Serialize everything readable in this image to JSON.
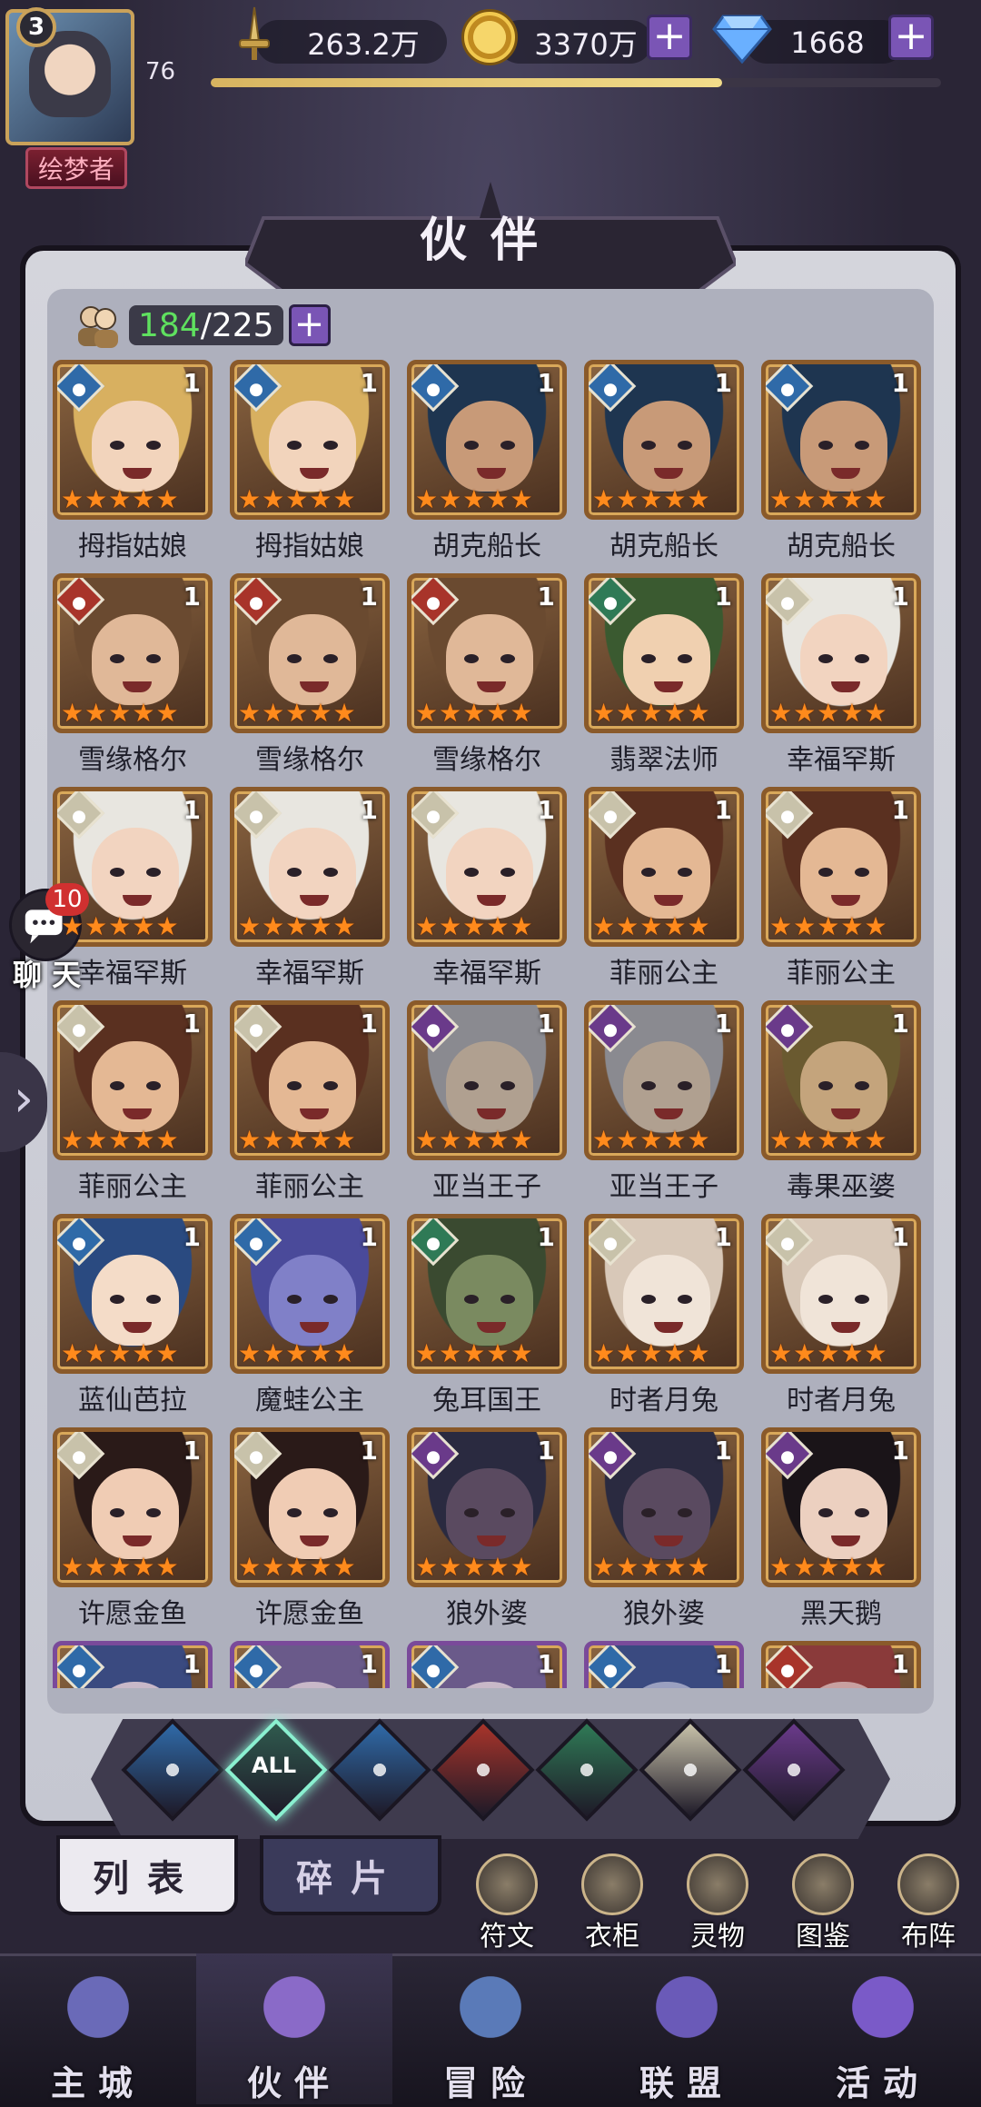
{
  "player": {
    "level": "3",
    "exp_level": "76",
    "title": "绘梦者",
    "exp_progress": 0.7
  },
  "resources": {
    "power": "263.2万",
    "gold": "3370万",
    "diamond": "1668"
  },
  "page": {
    "title": "伙伴"
  },
  "partner_count": {
    "current": "184",
    "total": "/225"
  },
  "colors": {
    "water": "#2f6aa8",
    "fire": "#a8342a",
    "wind": "#2f7a56",
    "light": "#c8c2aa",
    "dark": "#6a3a8a"
  },
  "partners": [
    {
      "name": "拇指姑娘",
      "element": "water",
      "count": "1",
      "stars": 5,
      "hair": "#d8b060",
      "skin": "#f2d4bc"
    },
    {
      "name": "拇指姑娘",
      "element": "water",
      "count": "1",
      "stars": 5,
      "hair": "#d8b060",
      "skin": "#f2d4bc"
    },
    {
      "name": "胡克船长",
      "element": "water",
      "count": "1",
      "stars": 5,
      "hair": "#1e3550",
      "skin": "#c89a78"
    },
    {
      "name": "胡克船长",
      "element": "water",
      "count": "1",
      "stars": 5,
      "hair": "#1e3550",
      "skin": "#c89a78"
    },
    {
      "name": "胡克船长",
      "element": "water",
      "count": "1",
      "stars": 5,
      "hair": "#1e3550",
      "skin": "#c89a78"
    },
    {
      "name": "雪缘格尔",
      "element": "fire",
      "count": "1",
      "stars": 5,
      "hair": "#6a4a30",
      "skin": "#e0b898"
    },
    {
      "name": "雪缘格尔",
      "element": "fire",
      "count": "1",
      "stars": 5,
      "hair": "#6a4a30",
      "skin": "#e0b898"
    },
    {
      "name": "雪缘格尔",
      "element": "fire",
      "count": "1",
      "stars": 5,
      "hair": "#6a4a30",
      "skin": "#e0b898"
    },
    {
      "name": "翡翠法师",
      "element": "wind",
      "count": "1",
      "stars": 5,
      "hair": "#3a5a30",
      "skin": "#f0d0b0"
    },
    {
      "name": "幸福罕斯",
      "element": "light",
      "count": "1",
      "stars": 5,
      "hair": "#e8e6e0",
      "skin": "#f2d4c0"
    },
    {
      "name": "幸福罕斯",
      "element": "light",
      "count": "1",
      "stars": 5,
      "hair": "#e8e6e0",
      "skin": "#f2d4c0"
    },
    {
      "name": "幸福罕斯",
      "element": "light",
      "count": "1",
      "stars": 5,
      "hair": "#e8e6e0",
      "skin": "#f2d4c0"
    },
    {
      "name": "幸福罕斯",
      "element": "light",
      "count": "1",
      "stars": 5,
      "hair": "#e8e6e0",
      "skin": "#f2d4c0"
    },
    {
      "name": "菲丽公主",
      "element": "light",
      "count": "1",
      "stars": 5,
      "hair": "#5a3020",
      "skin": "#e4b894"
    },
    {
      "name": "菲丽公主",
      "element": "light",
      "count": "1",
      "stars": 5,
      "hair": "#5a3020",
      "skin": "#e4b894"
    },
    {
      "name": "菲丽公主",
      "element": "light",
      "count": "1",
      "stars": 5,
      "hair": "#5a3020",
      "skin": "#e4b894"
    },
    {
      "name": "菲丽公主",
      "element": "light",
      "count": "1",
      "stars": 5,
      "hair": "#5a3020",
      "skin": "#e4b894"
    },
    {
      "name": "亚当王子",
      "element": "dark",
      "count": "1",
      "stars": 5,
      "hair": "#8a8a90",
      "skin": "#b0a090"
    },
    {
      "name": "亚当王子",
      "element": "dark",
      "count": "1",
      "stars": 5,
      "hair": "#8a8a90",
      "skin": "#b0a090"
    },
    {
      "name": "毒果巫婆",
      "element": "dark",
      "count": "1",
      "stars": 5,
      "hair": "#6a5a30",
      "skin": "#c4a47c"
    },
    {
      "name": "蓝仙芭拉",
      "element": "water",
      "count": "1",
      "stars": 5,
      "hair": "#2a4a80",
      "skin": "#f4dcc8"
    },
    {
      "name": "魔蛙公主",
      "element": "water",
      "count": "1",
      "stars": 5,
      "hair": "#4a4a9a",
      "skin": "#8080c8"
    },
    {
      "name": "兔耳国王",
      "element": "wind",
      "count": "1",
      "stars": 5,
      "hair": "#3a4a30",
      "skin": "#7a8a60"
    },
    {
      "name": "时者月兔",
      "element": "light",
      "count": "1",
      "stars": 5,
      "hair": "#d8c8b8",
      "skin": "#f0e4d8"
    },
    {
      "name": "时者月兔",
      "element": "light",
      "count": "1",
      "stars": 5,
      "hair": "#d8c8b8",
      "skin": "#f0e4d8"
    },
    {
      "name": "许愿金鱼",
      "element": "light",
      "count": "1",
      "stars": 5,
      "hair": "#2a1a18",
      "skin": "#f0ccb4"
    },
    {
      "name": "许愿金鱼",
      "element": "light",
      "count": "1",
      "stars": 5,
      "hair": "#2a1a18",
      "skin": "#f0ccb4"
    },
    {
      "name": "狼外婆",
      "element": "dark",
      "count": "1",
      "stars": 5,
      "hair": "#2a2a40",
      "skin": "#5a4a60"
    },
    {
      "name": "狼外婆",
      "element": "dark",
      "count": "1",
      "stars": 5,
      "hair": "#2a2a40",
      "skin": "#5a4a60"
    },
    {
      "name": "黑天鹅",
      "element": "dark",
      "count": "1",
      "stars": 5,
      "hair": "#1a1418",
      "skin": "#ecd0c0"
    },
    {
      "name": "",
      "element": "water",
      "count": "1",
      "stars": 0,
      "hair": "#3a4a80",
      "skin": "#c8b8c8"
    },
    {
      "name": "",
      "element": "water",
      "count": "1",
      "stars": 0,
      "hair": "#6a5a8a",
      "skin": "#c8b8c8"
    },
    {
      "name": "",
      "element": "water",
      "count": "1",
      "stars": 0,
      "hair": "#6a5a8a",
      "skin": "#c8b8c8"
    },
    {
      "name": "",
      "element": "water",
      "count": "1",
      "stars": 0,
      "hair": "#3a4a80",
      "skin": "#9aa0c0"
    },
    {
      "name": "",
      "element": "fire",
      "count": "1",
      "stars": 0,
      "hair": "#8a3a3a",
      "skin": "#c8a0a0"
    }
  ],
  "filters": [
    {
      "id": "all-water",
      "label": "",
      "color": "#2f6aa8",
      "active": false
    },
    {
      "id": "all",
      "label": "ALL",
      "color": "#2f5a4e",
      "active": true
    },
    {
      "id": "water",
      "label": "",
      "color": "#2f6aa8",
      "active": false
    },
    {
      "id": "fire",
      "label": "",
      "color": "#a8342a",
      "active": false
    },
    {
      "id": "wind",
      "label": "",
      "color": "#2f7a56",
      "active": false
    },
    {
      "id": "light",
      "label": "",
      "color": "#c8c2aa",
      "active": false
    },
    {
      "id": "dark",
      "label": "",
      "color": "#6a3a8a",
      "active": false
    }
  ],
  "tabs": {
    "list": "列表",
    "fragments": "碎片"
  },
  "tools": [
    "符文",
    "衣柜",
    "灵物",
    "图鉴",
    "布阵"
  ],
  "chat": {
    "badge": "10",
    "label": "聊 天"
  },
  "nav": [
    "主城",
    "伙伴",
    "冒险",
    "联盟",
    "活动"
  ],
  "nav_active": 1
}
